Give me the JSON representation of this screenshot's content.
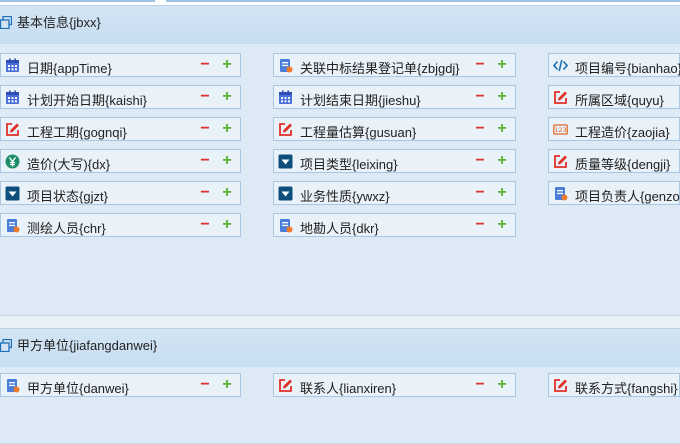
{
  "section1": {
    "title": "基本信息{jbxx}",
    "fields": [
      {
        "label": "日期{appTime}",
        "icon": "calendar-icon"
      },
      {
        "label": "关联中标结果登记单{zbjgdj}",
        "icon": "form-icon"
      },
      {
        "label": "项目编号{bianhao}",
        "icon": "code-icon"
      },
      {
        "label": "计划开始日期{kaishi}",
        "icon": "calendar-icon"
      },
      {
        "label": "计划结束日期{jieshu}",
        "icon": "calendar-icon"
      },
      {
        "label": "所属区域{quyu}",
        "icon": "edit-icon"
      },
      {
        "label": "工程工期{gognqi}",
        "icon": "edit-icon"
      },
      {
        "label": "工程量估算{gusuan}",
        "icon": "edit-icon"
      },
      {
        "label": "工程造价{zaojia}",
        "icon": "number-icon"
      },
      {
        "label": "造价(大写){dx}",
        "icon": "yen-icon"
      },
      {
        "label": "项目类型{leixing}",
        "icon": "dropdown-icon"
      },
      {
        "label": "质量等级{dengji}",
        "icon": "edit-icon"
      },
      {
        "label": "项目状态{gjzt}",
        "icon": "dropdown-icon"
      },
      {
        "label": "业务性质{ywxz}",
        "icon": "dropdown-icon"
      },
      {
        "label": "项目负责人{genzong}",
        "icon": "form-icon"
      },
      {
        "label": "测绘人员{chr}",
        "icon": "form-icon"
      },
      {
        "label": "地勘人员{dkr}",
        "icon": "form-icon"
      }
    ]
  },
  "section2": {
    "title": "甲方单位{jiafangdanwei}",
    "fields": [
      {
        "label": "甲方单位{danwei}",
        "icon": "form-icon"
      },
      {
        "label": "联系人{lianxiren}",
        "icon": "edit-icon"
      },
      {
        "label": "联系方式{fangshi}",
        "icon": "edit-icon"
      }
    ]
  },
  "controls": {
    "minus": "−",
    "plus": "+"
  },
  "colors": {
    "minus": "#e0312b",
    "plus": "#58b22e",
    "header": "#c7ddf1",
    "calendar": "#4a6fd9",
    "edit": "#e0312b",
    "dropdown": "#0d4e7a",
    "yen": "#1f8f6a"
  }
}
